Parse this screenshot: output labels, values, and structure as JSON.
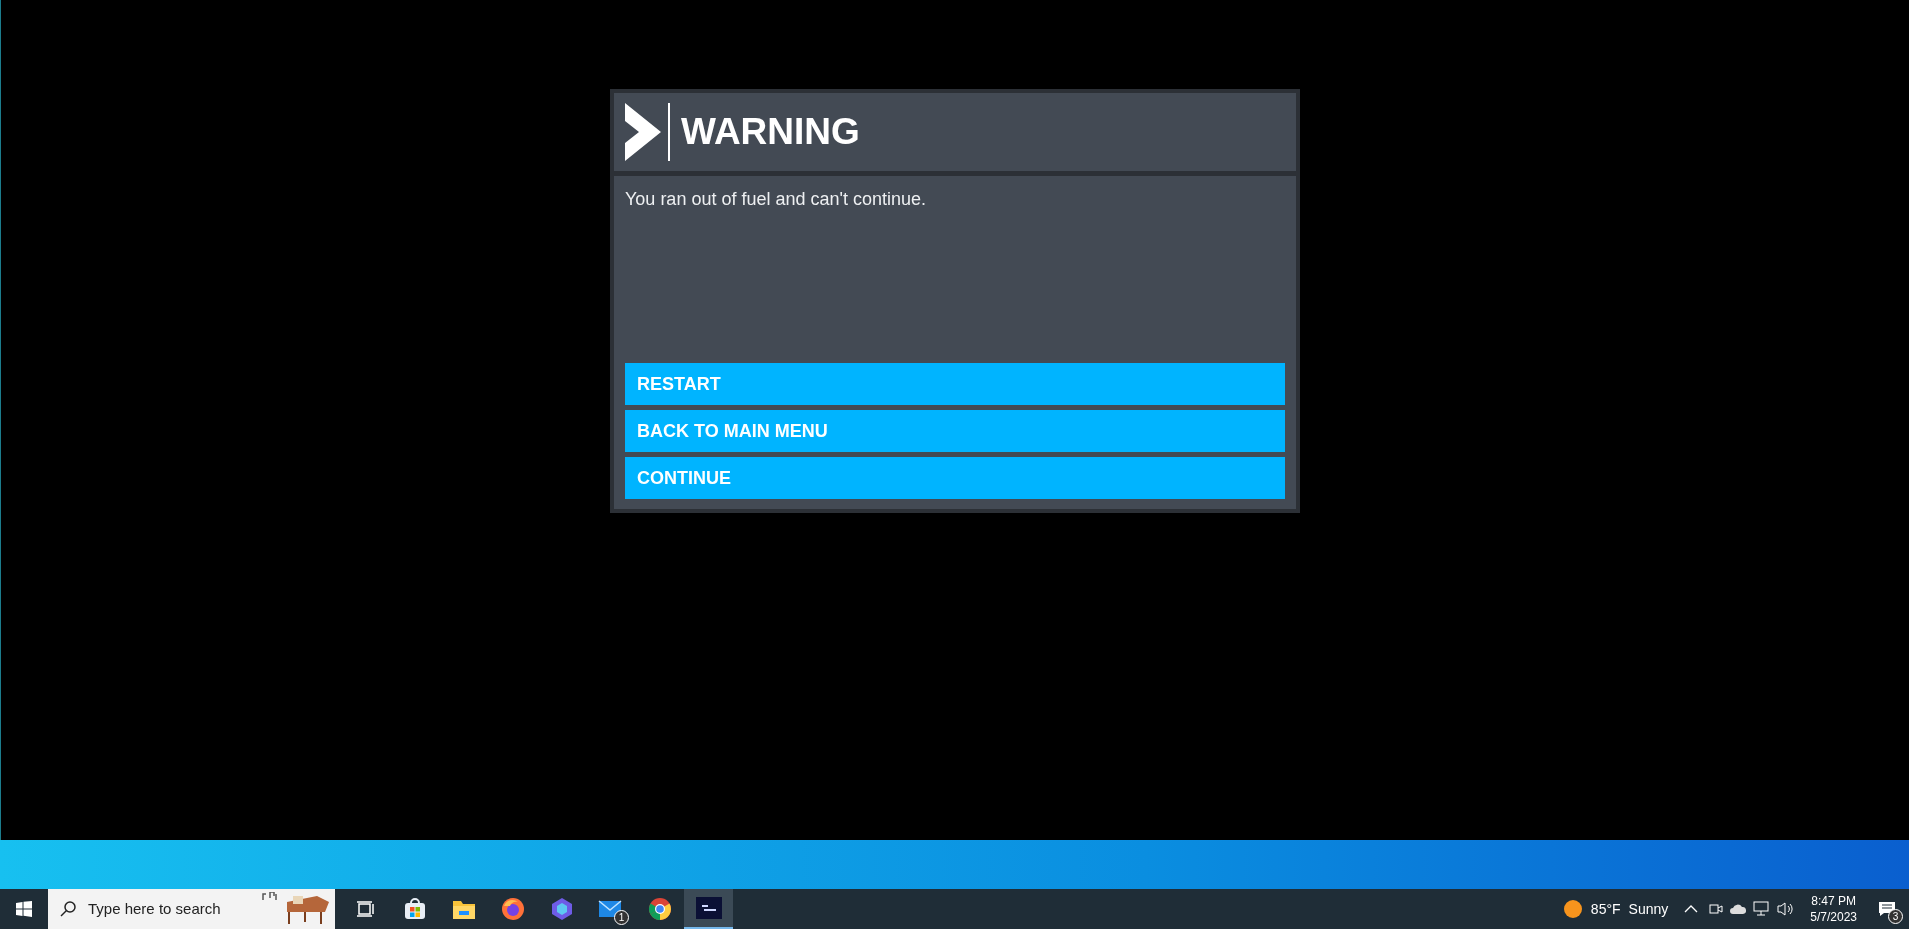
{
  "dialog": {
    "title": "WARNING",
    "message": "You ran out of fuel and can't continue.",
    "buttons": [
      "RESTART",
      "BACK TO MAIN MENU",
      "CONTINUE"
    ]
  },
  "taskbar": {
    "search": {
      "placeholder": "Type here to search"
    },
    "apps": [
      {
        "kind": "taskview",
        "selected": false
      },
      {
        "kind": "store",
        "selected": false
      },
      {
        "kind": "explorer",
        "selected": false
      },
      {
        "kind": "firefox",
        "selected": false
      },
      {
        "kind": "copilot",
        "selected": false
      },
      {
        "kind": "mail",
        "badge": "1",
        "selected": false
      },
      {
        "kind": "chrome",
        "selected": false
      },
      {
        "kind": "game",
        "selected": true
      }
    ],
    "weather": {
      "temperature": "85°F",
      "condition": "Sunny"
    },
    "clock": {
      "time": "8:47 PM",
      "date": "5/7/2023"
    },
    "notifications": {
      "count": "3"
    }
  }
}
